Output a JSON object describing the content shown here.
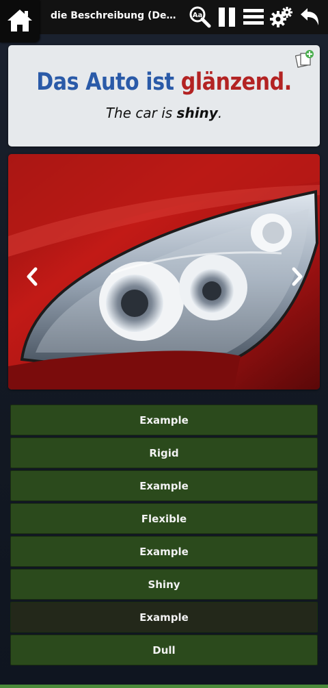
{
  "header": {
    "title": "die Beschreibung (Descripti...",
    "icons": [
      "home-icon",
      "zoom-text-icon",
      "pause-icon",
      "menu-icon",
      "settings-icon",
      "back-icon"
    ]
  },
  "card": {
    "sentence_start": "Das Auto ist ",
    "sentence_word": "glänzend",
    "sentence_end": ".",
    "translation_start": "The car is ",
    "translation_word": "shiny",
    "translation_end": ".",
    "icon": "add-flashcard-icon"
  },
  "image": {
    "subject": "red car headlight",
    "nav_icons": [
      "chevron-left-icon",
      "chevron-right-icon"
    ]
  },
  "options": [
    {
      "label": "Example"
    },
    {
      "label": "Rigid"
    },
    {
      "label": "Example"
    },
    {
      "label": "Flexible"
    },
    {
      "label": "Example"
    },
    {
      "label": "Shiny"
    },
    {
      "label": "Example"
    },
    {
      "label": "Dull"
    }
  ],
  "colors": {
    "accent_blue": "#2a5aa8",
    "highlight_red": "#b32323",
    "option_green": "#2b4a1c"
  }
}
